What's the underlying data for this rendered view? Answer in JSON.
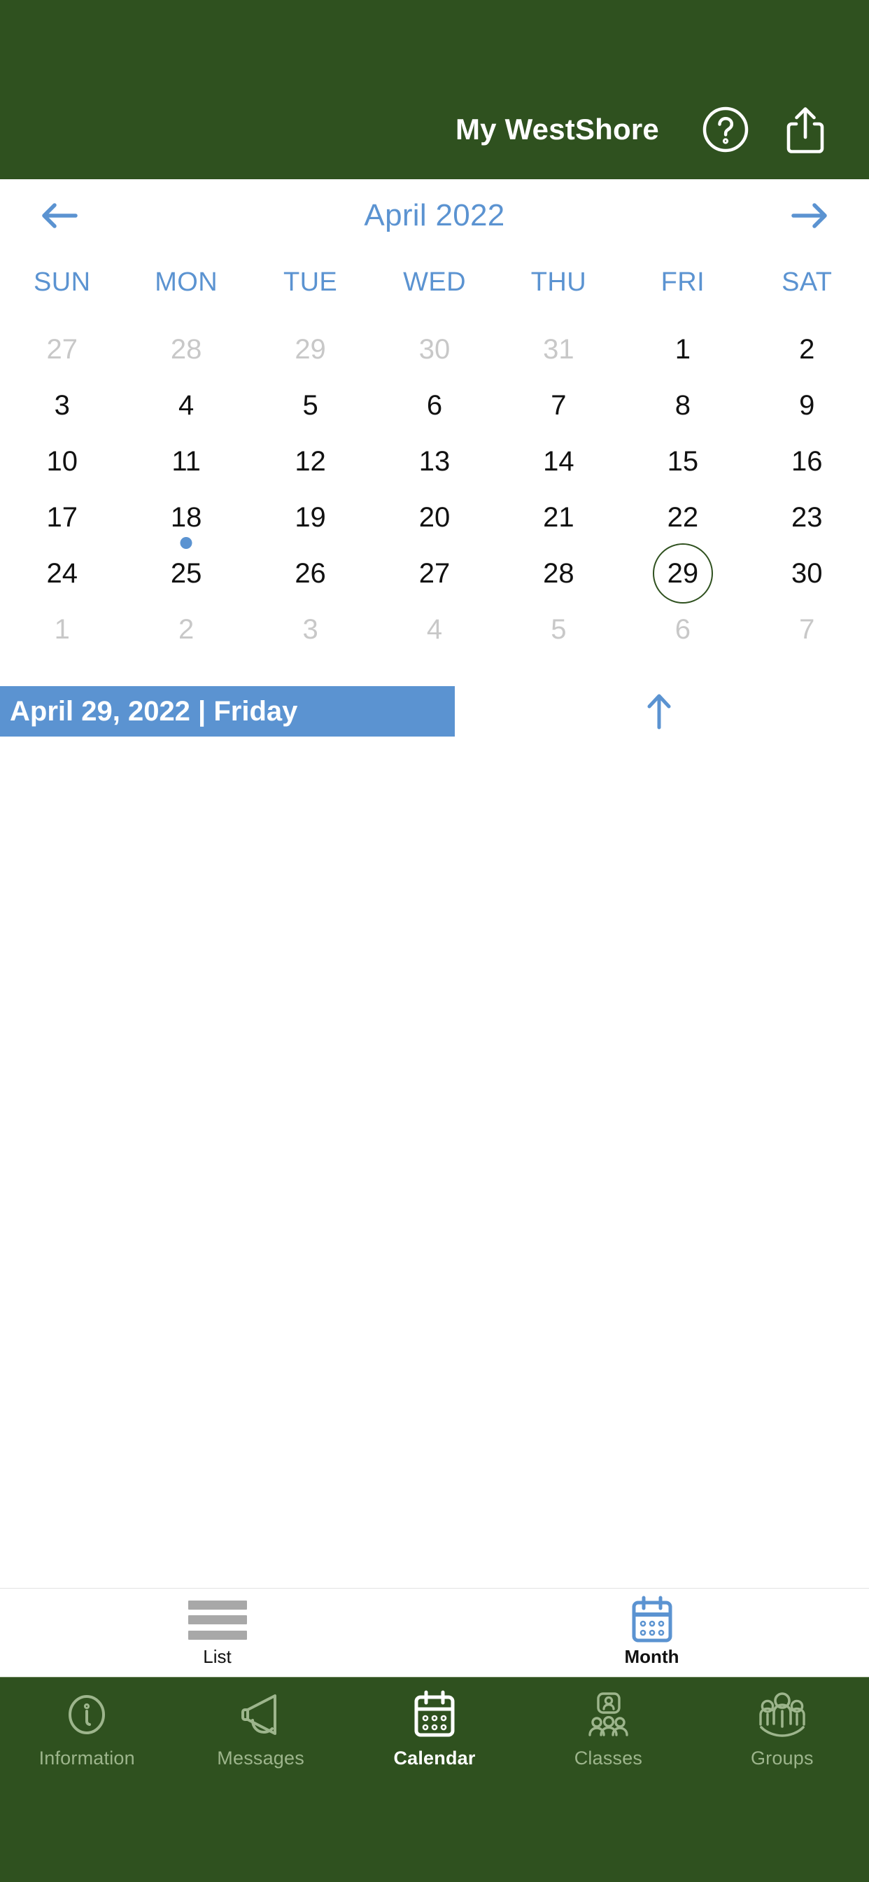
{
  "theme": {
    "brand_green": "#2F511F",
    "accent_blue": "#5B93D1",
    "muted_gray": "#c8c8c8",
    "tab_inactive": "#9DB58C"
  },
  "header": {
    "title": "My WestShore",
    "help_icon": "question-circle-icon",
    "share_icon": "share-icon"
  },
  "calendar": {
    "month_label": "April 2022",
    "prev_icon": "arrow-left-icon",
    "next_icon": "arrow-right-icon",
    "weekdays": [
      "SUN",
      "MON",
      "TUE",
      "WED",
      "THU",
      "FRI",
      "SAT"
    ],
    "weeks": [
      [
        {
          "day": "27",
          "current_month": false,
          "selected": false,
          "has_event": false
        },
        {
          "day": "28",
          "current_month": false,
          "selected": false,
          "has_event": false
        },
        {
          "day": "29",
          "current_month": false,
          "selected": false,
          "has_event": false
        },
        {
          "day": "30",
          "current_month": false,
          "selected": false,
          "has_event": false
        },
        {
          "day": "31",
          "current_month": false,
          "selected": false,
          "has_event": false
        },
        {
          "day": "1",
          "current_month": true,
          "selected": false,
          "has_event": false
        },
        {
          "day": "2",
          "current_month": true,
          "selected": false,
          "has_event": false
        }
      ],
      [
        {
          "day": "3",
          "current_month": true,
          "selected": false,
          "has_event": false
        },
        {
          "day": "4",
          "current_month": true,
          "selected": false,
          "has_event": false
        },
        {
          "day": "5",
          "current_month": true,
          "selected": false,
          "has_event": false
        },
        {
          "day": "6",
          "current_month": true,
          "selected": false,
          "has_event": false
        },
        {
          "day": "7",
          "current_month": true,
          "selected": false,
          "has_event": false
        },
        {
          "day": "8",
          "current_month": true,
          "selected": false,
          "has_event": false
        },
        {
          "day": "9",
          "current_month": true,
          "selected": false,
          "has_event": false
        }
      ],
      [
        {
          "day": "10",
          "current_month": true,
          "selected": false,
          "has_event": false
        },
        {
          "day": "11",
          "current_month": true,
          "selected": false,
          "has_event": false
        },
        {
          "day": "12",
          "current_month": true,
          "selected": false,
          "has_event": false
        },
        {
          "day": "13",
          "current_month": true,
          "selected": false,
          "has_event": false
        },
        {
          "day": "14",
          "current_month": true,
          "selected": false,
          "has_event": false
        },
        {
          "day": "15",
          "current_month": true,
          "selected": false,
          "has_event": false
        },
        {
          "day": "16",
          "current_month": true,
          "selected": false,
          "has_event": false
        }
      ],
      [
        {
          "day": "17",
          "current_month": true,
          "selected": false,
          "has_event": false
        },
        {
          "day": "18",
          "current_month": true,
          "selected": false,
          "has_event": true
        },
        {
          "day": "19",
          "current_month": true,
          "selected": false,
          "has_event": false
        },
        {
          "day": "20",
          "current_month": true,
          "selected": false,
          "has_event": false
        },
        {
          "day": "21",
          "current_month": true,
          "selected": false,
          "has_event": false
        },
        {
          "day": "22",
          "current_month": true,
          "selected": false,
          "has_event": false
        },
        {
          "day": "23",
          "current_month": true,
          "selected": false,
          "has_event": false
        }
      ],
      [
        {
          "day": "24",
          "current_month": true,
          "selected": false,
          "has_event": false
        },
        {
          "day": "25",
          "current_month": true,
          "selected": false,
          "has_event": false
        },
        {
          "day": "26",
          "current_month": true,
          "selected": false,
          "has_event": false
        },
        {
          "day": "27",
          "current_month": true,
          "selected": false,
          "has_event": false
        },
        {
          "day": "28",
          "current_month": true,
          "selected": false,
          "has_event": false
        },
        {
          "day": "29",
          "current_month": true,
          "selected": true,
          "has_event": false
        },
        {
          "day": "30",
          "current_month": true,
          "selected": false,
          "has_event": false
        }
      ],
      [
        {
          "day": "1",
          "current_month": false,
          "selected": false,
          "has_event": false
        },
        {
          "day": "2",
          "current_month": false,
          "selected": false,
          "has_event": false
        },
        {
          "day": "3",
          "current_month": false,
          "selected": false,
          "has_event": false
        },
        {
          "day": "4",
          "current_month": false,
          "selected": false,
          "has_event": false
        },
        {
          "day": "5",
          "current_month": false,
          "selected": false,
          "has_event": false
        },
        {
          "day": "6",
          "current_month": false,
          "selected": false,
          "has_event": false
        },
        {
          "day": "7",
          "current_month": false,
          "selected": false,
          "has_event": false
        }
      ]
    ]
  },
  "selected_date_banner": {
    "text": "April 29, 2022 | Friday",
    "collapse_icon": "arrow-up-icon"
  },
  "events": {
    "items": []
  },
  "view_toggle": {
    "items": [
      {
        "label": "List",
        "icon": "list-lines-icon",
        "active": false
      },
      {
        "label": "Month",
        "icon": "calendar-month-icon",
        "active": true
      }
    ]
  },
  "tabbar": {
    "items": [
      {
        "label": "Information",
        "icon": "info-circle-icon",
        "active": false
      },
      {
        "label": "Messages",
        "icon": "megaphone-icon",
        "active": false
      },
      {
        "label": "Calendar",
        "icon": "calendar-icon",
        "active": true
      },
      {
        "label": "Classes",
        "icon": "classes-icon",
        "active": false
      },
      {
        "label": "Groups",
        "icon": "groups-icon",
        "active": false
      }
    ]
  }
}
